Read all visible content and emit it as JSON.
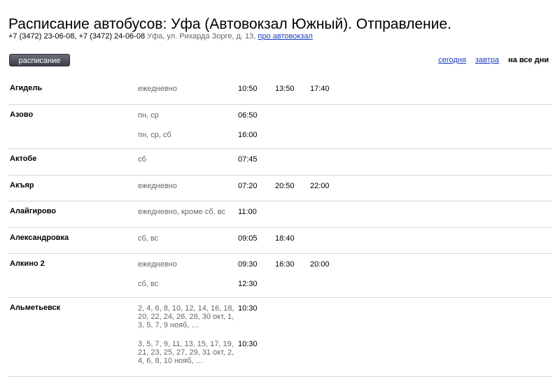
{
  "header": {
    "title": "Расписание автобусов: Уфа (Автовокзал Южный). Отправление.",
    "phones": "+7 (3472) 23-06-08, +7 (3472) 24-06-08",
    "address": "Уфа, ул. Рихарда Зорге, д. 13,",
    "about_link": "про автовокзал"
  },
  "tabs": {
    "schedule_label": "расписание"
  },
  "day_filter": {
    "today": "сегодня",
    "tomorrow": "завтра",
    "all_days": "на все дни"
  },
  "routes": [
    {
      "destination": "Агидель",
      "schedules": [
        {
          "days": "ежедневно",
          "times": [
            "10:50",
            "13:50",
            "17:40"
          ]
        }
      ]
    },
    {
      "destination": "Азово",
      "schedules": [
        {
          "days": "пн, ср",
          "times": [
            "06:50"
          ]
        },
        {
          "days": "пн, ср, сб",
          "times": [
            "16:00"
          ]
        }
      ]
    },
    {
      "destination": "Актобе",
      "schedules": [
        {
          "days": "сб",
          "times": [
            "07:45"
          ]
        }
      ]
    },
    {
      "destination": "Акъяр",
      "schedules": [
        {
          "days": "ежедневно",
          "times": [
            "07:20",
            "20:50",
            "22:00"
          ]
        }
      ]
    },
    {
      "destination": "Алайгирово",
      "schedules": [
        {
          "days": "ежедневно, кроме сб, вс",
          "times": [
            "11:00"
          ]
        }
      ]
    },
    {
      "destination": "Александровка",
      "schedules": [
        {
          "days": "сб, вс",
          "times": [
            "09:05",
            "18:40"
          ]
        }
      ]
    },
    {
      "destination": "Алкино 2",
      "schedules": [
        {
          "days": "ежедневно",
          "times": [
            "09:30",
            "16:30",
            "20:00"
          ]
        },
        {
          "days": "сб, вс",
          "times": [
            "12:30"
          ]
        }
      ]
    },
    {
      "destination": "Альметьевск",
      "schedules": [
        {
          "days": "2, 4, 6, 8, 10, 12, 14, 16, 18, 20, 22, 24, 26, 28, 30 окт, 1, 3, 5, 7, 9 нояб, …",
          "times": [
            "10:30"
          ]
        },
        {
          "days": "3, 5, 7, 9, 11, 13, 15, 17, 19, 21, 23, 25, 27, 29, 31 окт, 2, 4, 6, 8, 10 нояб, …",
          "times": [
            "10:30"
          ]
        }
      ]
    }
  ]
}
